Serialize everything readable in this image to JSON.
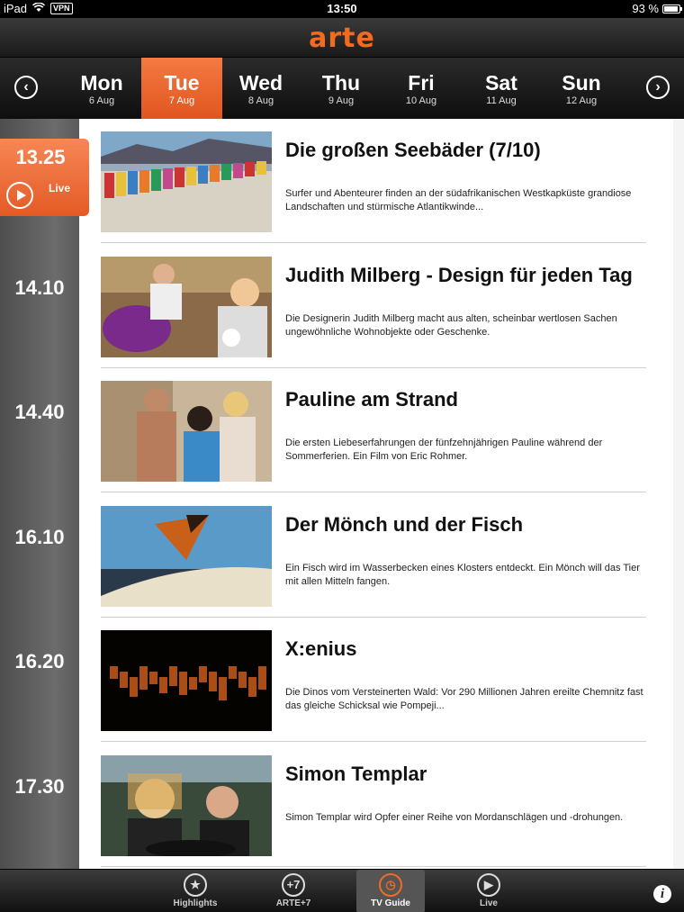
{
  "status": {
    "device": "iPad",
    "vpn": "VPN",
    "time": "13:50",
    "battery": "93 %",
    "battery_level": 0.93
  },
  "header": {
    "logo": "arte"
  },
  "days": [
    {
      "name": "Mon",
      "date": "6 Aug"
    },
    {
      "name": "Tue",
      "date": "7 Aug",
      "selected": true
    },
    {
      "name": "Wed",
      "date": "8 Aug"
    },
    {
      "name": "Thu",
      "date": "9 Aug"
    },
    {
      "name": "Fri",
      "date": "10 Aug"
    },
    {
      "name": "Sat",
      "date": "11 Aug"
    },
    {
      "name": "Sun",
      "date": "12 Aug"
    }
  ],
  "live": {
    "time": "13.25",
    "label": "Live"
  },
  "programs": [
    {
      "time": "13.25",
      "title": "Die großen Seebäder (7/10)",
      "desc": "Surfer und Abenteurer finden an der südafrikanischen Westkapküste grandiose Landschaften und stürmische Atlantikwinde..."
    },
    {
      "time": "14.10",
      "title": "Judith Milberg - Design für jeden Tag",
      "desc": "Die Designerin Judith Milberg macht aus alten, scheinbar wertlosen Sachen ungewöhnliche Wohnobjekte oder Geschenke."
    },
    {
      "time": "14.40",
      "title": "Pauline am Strand",
      "desc": "Die ersten Liebeserfahrungen der fünfzehnjährigen Pauline während der Sommerferien. Ein Film von Eric Rohmer."
    },
    {
      "time": "16.10",
      "title": "Der Mönch und der Fisch",
      "desc": "Ein Fisch wird im Wasserbecken eines Klosters entdeckt. Ein Mönch will das Tier mit allen Mitteln fangen."
    },
    {
      "time": "16.20",
      "title": "X:enius",
      "desc": "Die Dinos vom Versteinerten Wald: Vor 290 Millionen Jahren ereilte Chemnitz fast das gleiche Schicksal wie Pompeji..."
    },
    {
      "time": "17.30",
      "title": "Simon Templar",
      "desc": "Simon Templar wird Opfer einer Reihe von Mordanschlägen und -drohungen."
    }
  ],
  "tabs": [
    {
      "label": "Highlights",
      "icon": "star-icon",
      "glyph": "★"
    },
    {
      "label": "ARTE+7",
      "icon": "arte-plus7-icon",
      "glyph": "+7"
    },
    {
      "label": "TV Guide",
      "icon": "clock-icon",
      "glyph": "◷",
      "active": true
    },
    {
      "label": "Live",
      "icon": "play-icon",
      "glyph": "▶"
    }
  ],
  "info_glyph": "i",
  "colors": {
    "accent": "#f26b21",
    "timeline": "#5c5c5c"
  }
}
